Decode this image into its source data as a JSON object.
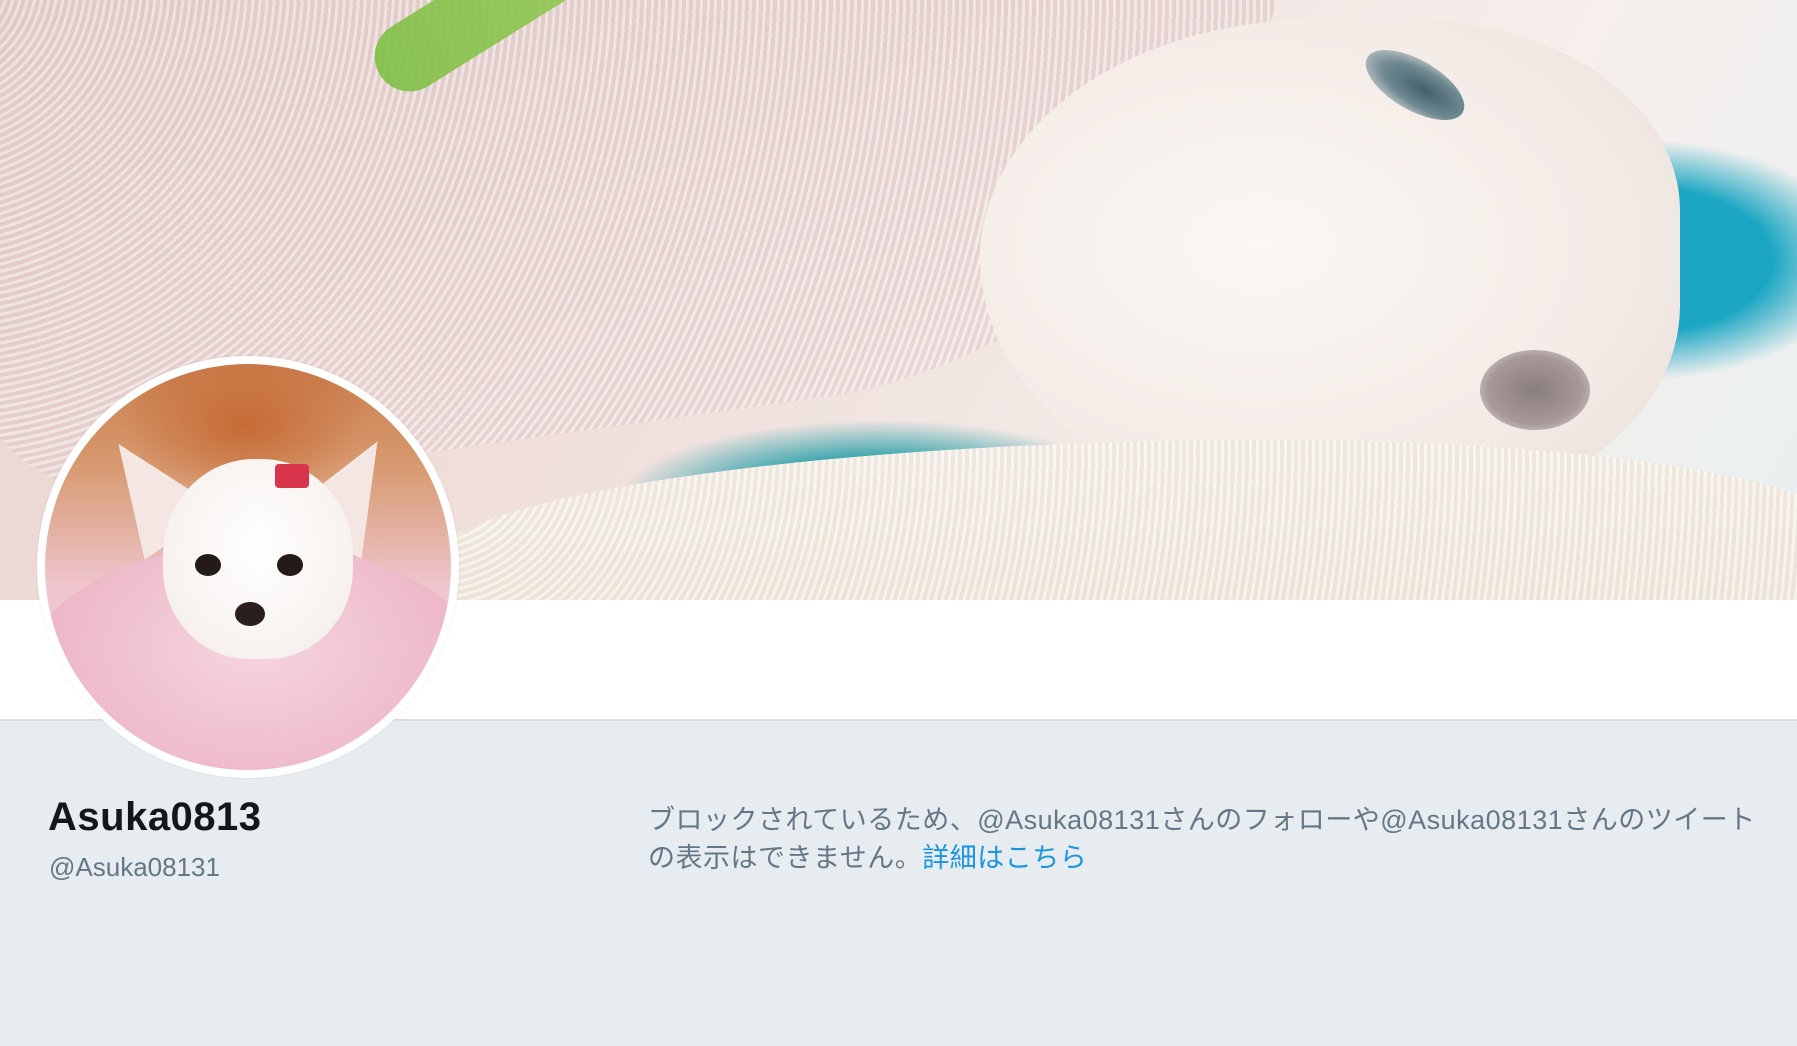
{
  "profile": {
    "display_name": "Asuka0813",
    "handle": "@Asuka08131"
  },
  "blocked_notice": {
    "message": "ブロックされているため、@Asuka08131さんのフォローや@Asuka08131さんのツイートの表示はできません。",
    "link_text": "詳細はこちら"
  },
  "colors": {
    "background": "#e6ecf0",
    "link": "#1b95e0",
    "name_text": "#14171a",
    "secondary_text": "#657786"
  }
}
